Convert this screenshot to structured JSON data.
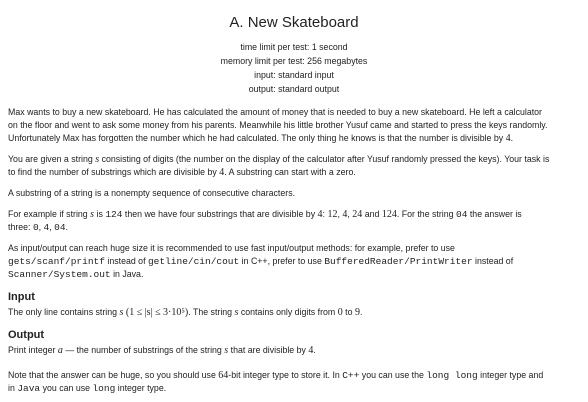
{
  "problem": {
    "title": "A. New Skateboard",
    "limits": {
      "time": "time limit per test: 1 second",
      "memory": "memory limit per test: 256 megabytes",
      "input": "input: standard input",
      "output": "output: standard output"
    },
    "statement": {
      "p1": {
        "l1": "Max wants to buy a new skateboard. He has calculated the amount of money that is needed to buy a new skateboard. He left a calculator",
        "l2": "on the floor and went to ask some money from his parents. Meanwhile his little brother Yusuf came and started to press the keys randomly.",
        "l3": "Unfortunately Max has forgotten the number which he had calculated. The only thing he knows is that the number is divisible by",
        "l3_num": "4",
        "l3_end": "."
      },
      "p2": {
        "a": "You are given a string",
        "s": "s",
        "b": "consisting of digits (the number on the display of the calculator after Yusuf randomly pressed the keys). Your task is",
        "c": "to find the number of substrings which are divisible by",
        "num": "4",
        "d": ". A substring can start with a zero."
      },
      "p3": "A substring of a string is a nonempty sequence of consecutive characters.",
      "p4": {
        "a": "For example if string",
        "s": "s",
        "b": "is",
        "code1": "124",
        "c": "then we have four substrings that are divisible by",
        "num4": "4",
        "d": ":",
        "v1": "12",
        "v2": "4",
        "v3": "24",
        "e": "and",
        "v4": "124",
        "f": ". For the string",
        "code2": "04",
        "g": "the answer is",
        "h": "three:",
        "code3": "0",
        "code4": "4",
        "code5": "04",
        "i": "."
      },
      "p5": {
        "a": "As input/output can reach huge size it is recommended to use fast input/output methods: for example, prefer to use",
        "code1": "gets/scanf/printf",
        "b": "instead of",
        "code2": "getline/cin/cout",
        "c": "in C++, prefer to use",
        "code3": "BufferedReader/PrintWriter",
        "d": "instead of",
        "code4": "Scanner/System.out",
        "e": "in Java."
      }
    },
    "input": {
      "title": "Input",
      "a": "The only line contains string",
      "s": "s",
      "constraint": "(1 ≤ |s| ≤ 3·10⁵)",
      "b": ". The string",
      "s2": "s",
      "c": "contains only digits from",
      "d0": "0",
      "to": "to",
      "d9": "9",
      "end": "."
    },
    "output": {
      "title": "Output",
      "a": "Print integer",
      "var": "a",
      "b": "— the number of substrings of the string",
      "s": "s",
      "c": "that are divisible by",
      "num": "4",
      "end": "."
    },
    "note": {
      "a": "Note that the answer can be huge, so you should use",
      "num": "64",
      "b": "-bit integer type to store it. In",
      "cpp": "C++",
      "c": "you can use the",
      "code1": "long long",
      "d": "integer type and",
      "e": "in",
      "java": "Java",
      "f": "you can use",
      "code2": "long",
      "g": "integer type."
    }
  }
}
